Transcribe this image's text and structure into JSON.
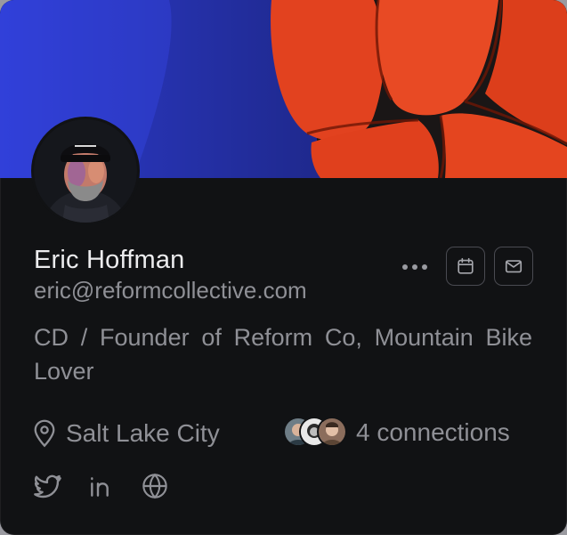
{
  "profile": {
    "name": "Eric Hoffman",
    "email": "eric@reformcollective.com",
    "bio": "CD / Founder of Reform Co, Mountain Bike Lover",
    "location": "Salt Lake City",
    "connections": "4 connections"
  },
  "actions": {
    "more_icon": "more-horizontal-icon",
    "calendar_icon": "calendar-icon",
    "mail_icon": "mail-icon"
  },
  "social": {
    "twitter_icon": "twitter-icon",
    "linkedin_icon": "linkedin-icon",
    "website_icon": "globe-icon"
  },
  "colors": {
    "card_background": "#111214",
    "name_text": "#ececee",
    "secondary_text": "#8f9096",
    "cover_blue": "#2f3ed8",
    "cover_red": "#e2421f"
  }
}
